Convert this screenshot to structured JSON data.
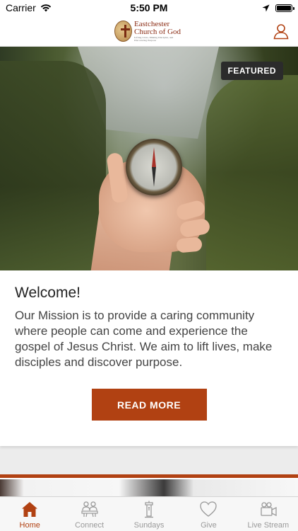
{
  "status_bar": {
    "carrier": "Carrier",
    "time": "5:50 PM"
  },
  "header": {
    "logo": {
      "line1": "Eastchester",
      "line2": "Church of God",
      "tagline": "Lifting Lives, Making Disciples, and Discovering Purpose"
    },
    "profile_icon": "person-icon"
  },
  "featured_card": {
    "badge": "FEATURED",
    "title": "Welcome!",
    "body": "Our Mission is to provide a caring community where people can come and experience the gospel of Jesus Christ. We aim to lift lives, make disciples and discover purpose.",
    "button_label": "READ MORE"
  },
  "colors": {
    "accent": "#b14112",
    "inactive": "#999999"
  },
  "tabs": [
    {
      "label": "Home",
      "icon": "home-icon",
      "active": true
    },
    {
      "label": "Connect",
      "icon": "people-icon",
      "active": false
    },
    {
      "label": "Sundays",
      "icon": "pulpit-icon",
      "active": false
    },
    {
      "label": "Give",
      "icon": "heart-icon",
      "active": false
    },
    {
      "label": "Live Stream",
      "icon": "video-camera-icon",
      "active": false
    }
  ]
}
